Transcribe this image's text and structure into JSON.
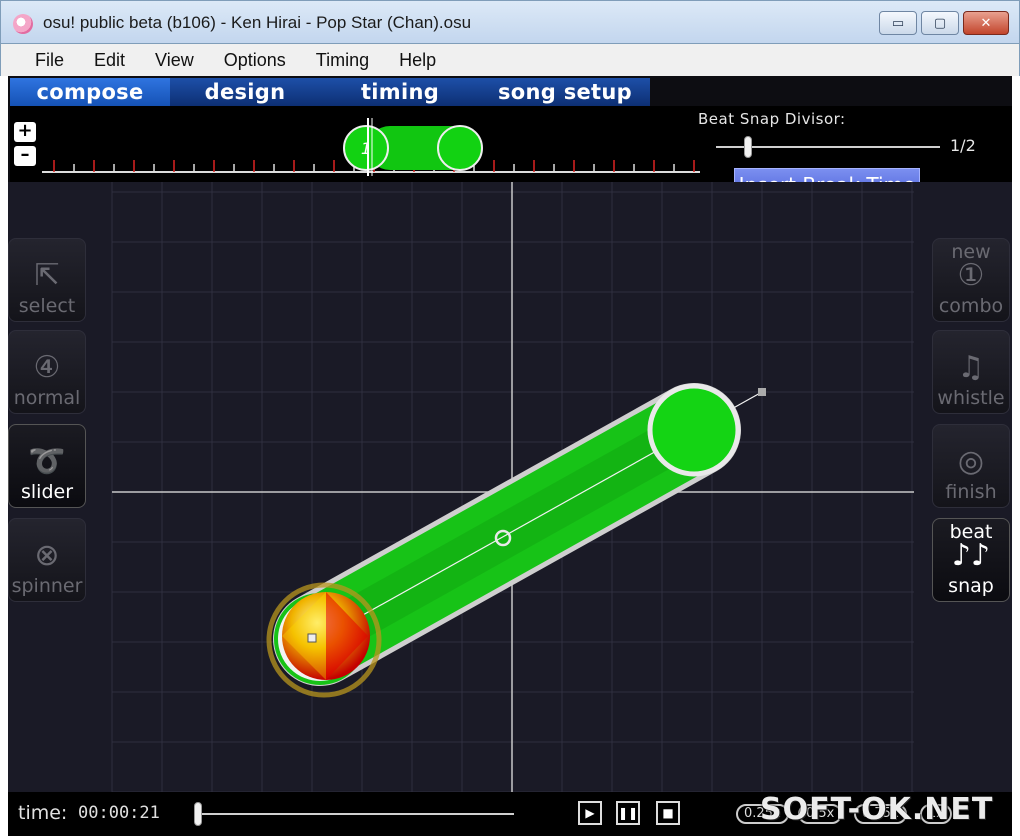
{
  "window": {
    "title": "osu! public beta (b106) - Ken Hirai - Pop Star (Chan).osu",
    "minimize_glyph": "▭",
    "maximize_glyph": "▢",
    "close_glyph": "✕"
  },
  "menu": [
    "File",
    "Edit",
    "View",
    "Options",
    "Timing",
    "Help"
  ],
  "modes": {
    "active": "compose",
    "tabs": [
      "compose",
      "design",
      "timing",
      "song setup"
    ]
  },
  "timeline": {
    "zoom_in": "+",
    "zoom_out": "–",
    "combo_number": "1"
  },
  "beat_snap": {
    "label": "Beat Snap Divisor:",
    "value": "1/2"
  },
  "insert_break_label": "Insert Break Time",
  "tools_left": [
    {
      "label": "select",
      "icon": "cursor-icon",
      "glyph": "⇱"
    },
    {
      "label": "normal",
      "icon": "hitcircle-icon",
      "glyph": "④"
    },
    {
      "label": "slider",
      "icon": "slider-icon",
      "glyph": "➰"
    },
    {
      "label": "spinner",
      "icon": "spinner-icon",
      "glyph": "⊗"
    }
  ],
  "tools_right": [
    {
      "label_top": "new",
      "label": "combo",
      "icon": "new-combo-icon",
      "glyph": "①"
    },
    {
      "label": "whistle",
      "icon": "whistle-icon",
      "glyph": "♫"
    },
    {
      "label": "finish",
      "icon": "cymbal-icon",
      "glyph": "◎"
    },
    {
      "label_top": "beat",
      "label": "snap",
      "icon": "beat-snap-icon",
      "glyph": "♪♪"
    }
  ],
  "status": {
    "time_label": "time:",
    "time_value": "00:00:21",
    "play_glyph": "▶",
    "pause_glyph": "❚❚",
    "stop_glyph": "■",
    "speed_badges": [
      "0.25x",
      "0.5x",
      "0.75x",
      "1x"
    ]
  },
  "watermark": "SOFT-OK.NET",
  "colors": {
    "slider_body": "#17c317",
    "slider_border": "#d8d8d8",
    "active_tab": "#2f74e0",
    "break_button": "#5b70e0"
  }
}
